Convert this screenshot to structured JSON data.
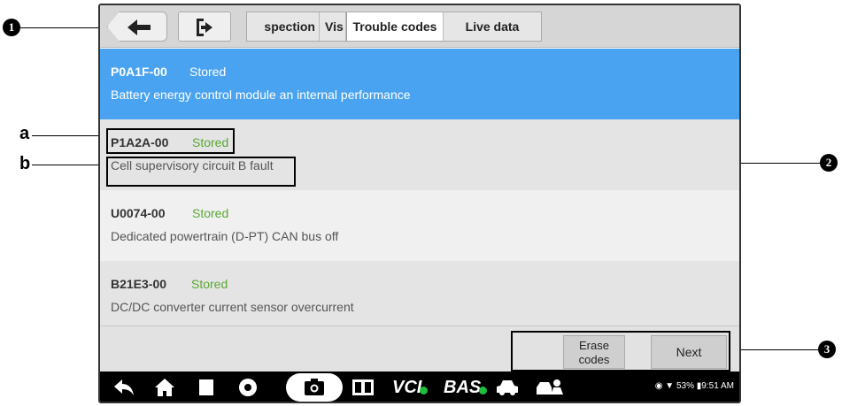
{
  "header": {
    "tabs": [
      {
        "label": "Inspection",
        "visible_text": "spection"
      },
      {
        "label": "Vis",
        "visible_text": "Vis"
      },
      {
        "label": "Trouble codes",
        "visible_text": "Trouble codes",
        "active": true
      },
      {
        "label": "Live data",
        "visible_text": "Live data"
      }
    ],
    "back_icon": "arrow-left-icon",
    "exit_icon": "exit-icon"
  },
  "codes": [
    {
      "code": "P0A1F-00",
      "status": "Stored",
      "description": "Battery energy control module an internal performance",
      "selected": true
    },
    {
      "code": "P1A2A-00",
      "status": "Stored",
      "description": "Cell supervisory circuit B fault",
      "selected": false
    },
    {
      "code": "U0074-00",
      "status": "Stored",
      "description": "Dedicated powertrain (D-PT) CAN bus off",
      "selected": false
    },
    {
      "code": "B21E3-00",
      "status": "Stored",
      "description": "DC/DC converter current sensor overcurrent",
      "selected": false
    }
  ],
  "actions": {
    "erase_line1": "Erase",
    "erase_line2": "codes",
    "next": "Next"
  },
  "navbar": {
    "vci": "VCI",
    "bas": "BAS",
    "battery": "53%",
    "time": "9:51 AM"
  },
  "callouts": {
    "one": "1",
    "two": "2",
    "three": "3",
    "a": "a",
    "b": "b"
  },
  "colors": {
    "selected_row": "#4aa3f0",
    "status_green": "#5aa832",
    "toolbar": "#d6d6d6"
  }
}
